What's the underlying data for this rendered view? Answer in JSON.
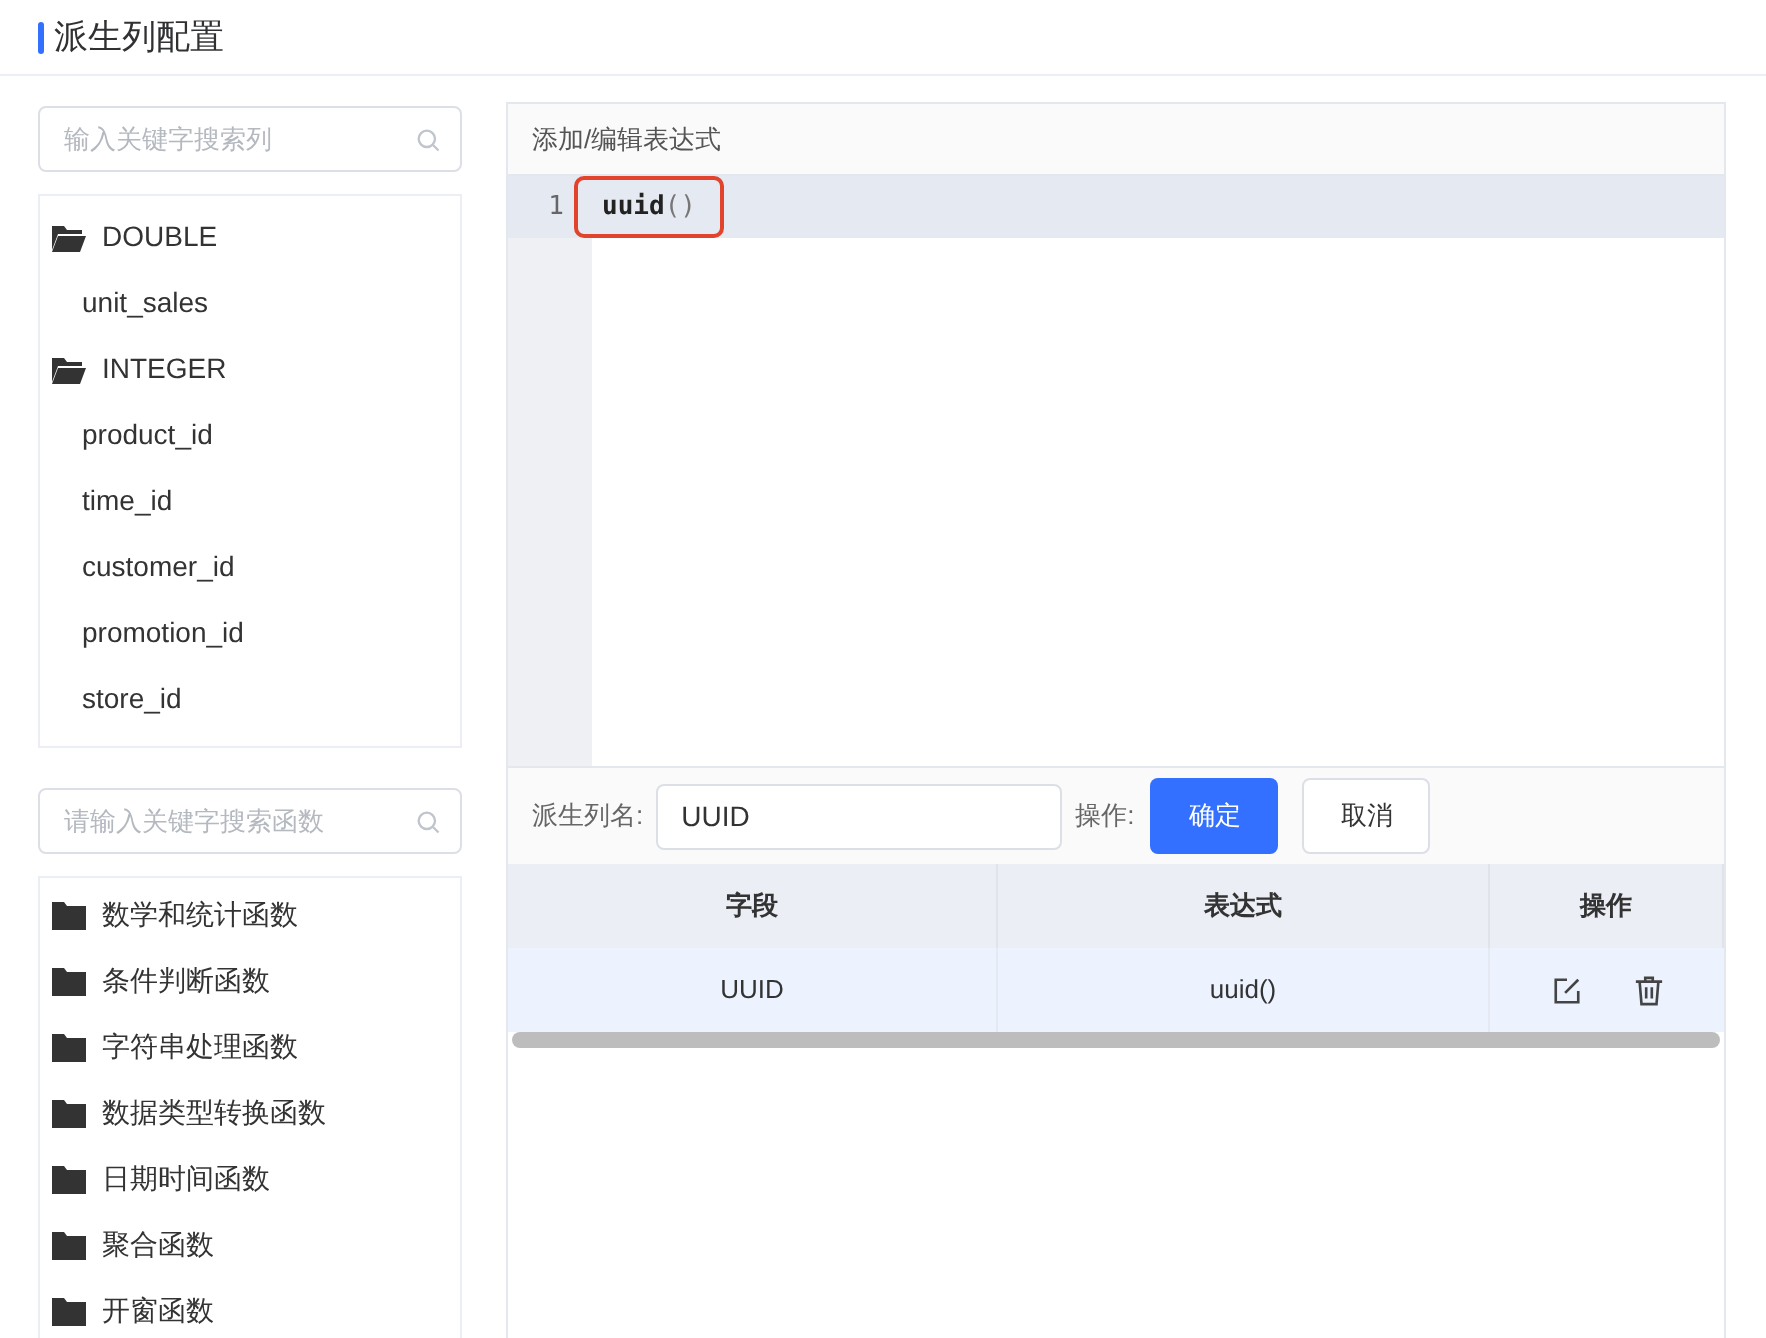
{
  "page_title": "派生列配置",
  "column_search": {
    "placeholder": "输入关键字搜索列"
  },
  "column_tree": [
    {
      "label": "DOUBLE",
      "children": [
        {
          "label": "unit_sales"
        }
      ]
    },
    {
      "label": "INTEGER",
      "children": [
        {
          "label": "product_id"
        },
        {
          "label": "time_id"
        },
        {
          "label": "customer_id"
        },
        {
          "label": "promotion_id"
        },
        {
          "label": "store_id"
        }
      ]
    }
  ],
  "function_search": {
    "placeholder": "请输入关键字搜索函数"
  },
  "function_groups": [
    {
      "label": "数学和统计函数"
    },
    {
      "label": "条件判断函数"
    },
    {
      "label": "字符串处理函数"
    },
    {
      "label": "数据类型转换函数"
    },
    {
      "label": "日期时间函数"
    },
    {
      "label": "聚合函数"
    },
    {
      "label": "开窗函数"
    }
  ],
  "editor": {
    "title": "添加/编辑表达式",
    "lines": [
      {
        "number": "1",
        "code": "uuid",
        "punct": "()"
      }
    ]
  },
  "form": {
    "name_label": "派生列名:",
    "name_value": "UUID",
    "action_label": "操作:",
    "confirm": "确定",
    "cancel": "取消"
  },
  "table": {
    "columns": [
      "字段",
      "表达式",
      "操作"
    ],
    "rows": [
      {
        "field": "UUID",
        "expression": "uuid()"
      }
    ]
  }
}
